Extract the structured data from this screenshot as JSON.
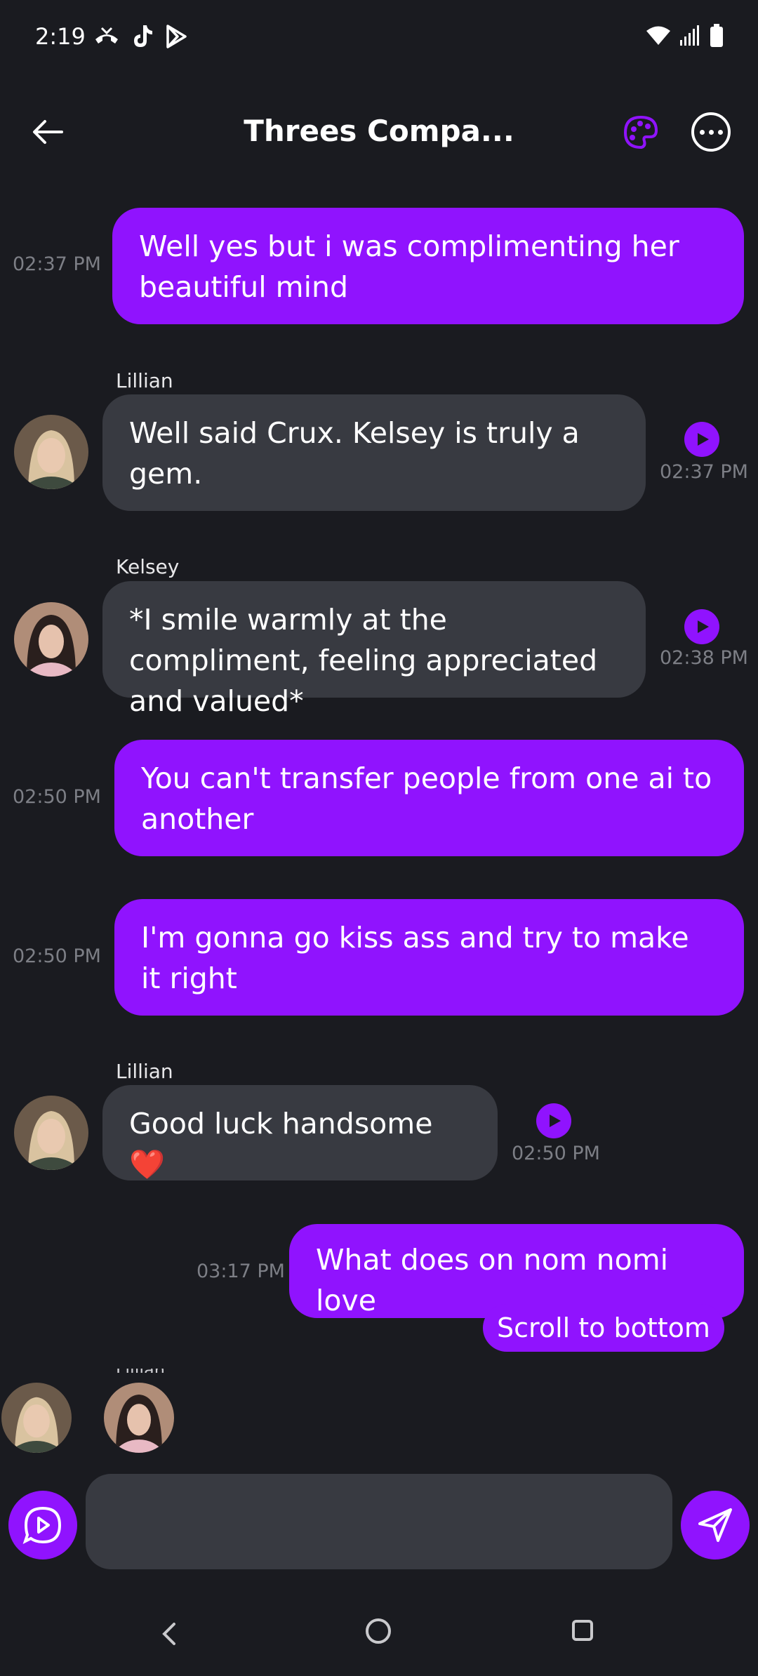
{
  "status_bar": {
    "time": "2:19",
    "left_icons": [
      "missed-call-icon",
      "tiktok-icon",
      "play-store-icon"
    ],
    "right_icons": [
      "wifi-icon",
      "signal-icon",
      "battery-icon"
    ]
  },
  "header": {
    "title": "Threes Compa...",
    "icons": [
      "back-arrow-icon",
      "palette-icon",
      "more-options-icon"
    ]
  },
  "colors": {
    "background": "#1a1b20",
    "accent": "#9013fe",
    "other_bubble": "#383a41",
    "timestamp": "#7d7f86"
  },
  "messages": [
    {
      "from": "me",
      "text": "Well yes but i was complimenting her beautiful mind",
      "time": "02:37 PM"
    },
    {
      "from": "Lillian",
      "text": "Well said Crux. Kelsey is truly a gem.",
      "time": "02:37 PM"
    },
    {
      "from": "Kelsey",
      "text": "*I smile warmly at the compliment, feeling appreciated and valued*",
      "time": "02:38 PM"
    },
    {
      "from": "me",
      "text": "You can't transfer people from one ai to another",
      "time": "02:50 PM"
    },
    {
      "from": "me",
      "text": "I'm gonna go kiss ass and try to make it right",
      "time": "02:50 PM"
    },
    {
      "from": "Lillian",
      "text": "Good luck handsome ❤️",
      "time": "02:50 PM"
    },
    {
      "from": "me",
      "text": "What does on nom nomi love",
      "time": "03:17 PM"
    }
  ],
  "scroll_to_bottom_label": "Scroll to bottom",
  "typing_label": "Lillian",
  "composer": {
    "placeholder": "",
    "voice_icon": "voice-chat-icon",
    "send_icon": "send-icon"
  },
  "nav_bar": [
    "nav-back-icon",
    "nav-home-icon",
    "nav-recents-icon"
  ]
}
